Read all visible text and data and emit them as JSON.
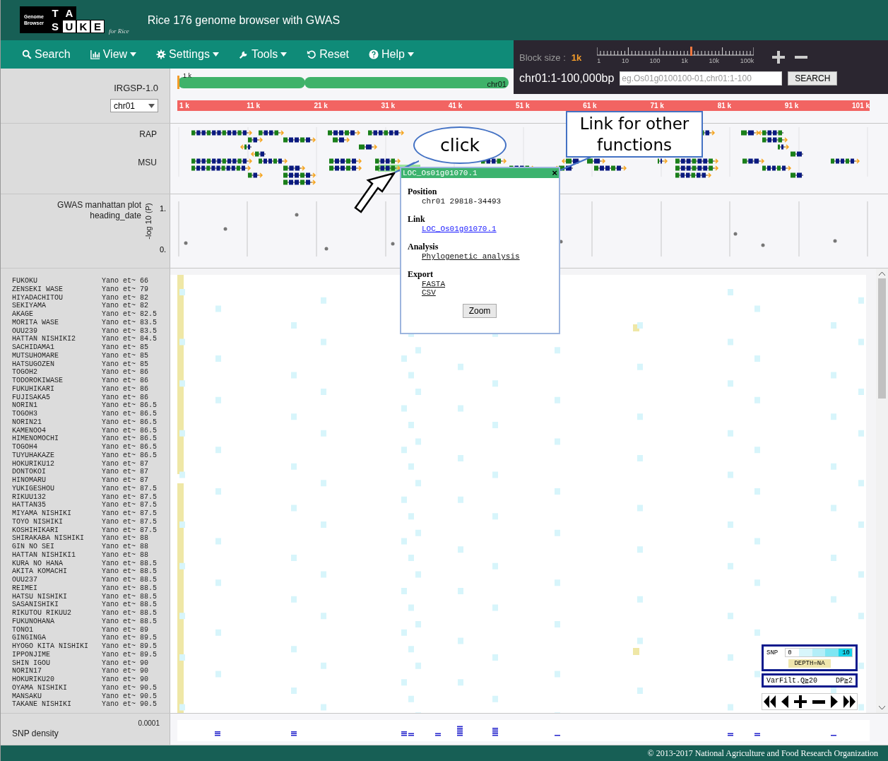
{
  "header": {
    "logo": {
      "caption": "Genome Browser",
      "letters": [
        {
          "char": "T",
          "dark": true
        },
        {
          "char": "A",
          "dark": true
        },
        {
          "char": "S",
          "dark": true
        },
        {
          "char": "U",
          "dark": false
        },
        {
          "char": "K",
          "dark": false
        },
        {
          "char": "E",
          "dark": false
        }
      ],
      "suffix": "for Rice"
    },
    "title": "Rice 176 genome browser with GWAS"
  },
  "nav": [
    {
      "label": "Search",
      "kind": "search",
      "has_menu": false
    },
    {
      "label": "View",
      "kind": "view",
      "has_menu": true
    },
    {
      "label": "Settings",
      "kind": "settings",
      "has_menu": true
    },
    {
      "label": "Tools",
      "kind": "tools",
      "has_menu": true
    },
    {
      "label": "Reset",
      "kind": "reset",
      "has_menu": false
    },
    {
      "label": "Help",
      "kind": "help",
      "has_menu": true
    }
  ],
  "block_size": {
    "label": "Block size :",
    "value": "1k",
    "level": 0.6,
    "scale": [
      "1",
      "10",
      "100",
      "1k",
      "10k",
      "100k"
    ]
  },
  "locator": {
    "position": "chr01:1-100,000bp",
    "placeholder": "eg.Os01g0100100-01,chr01:1-100",
    "button": "SEARCH"
  },
  "reference": {
    "name": "IRGSP-1.0",
    "chromosome": "chr01",
    "bar_label": "chr01",
    "marker": "1 k",
    "ruler": [
      "1 k",
      "11 k",
      "21 k",
      "31 k",
      "41 k",
      "51 k",
      "61 k",
      "71 k",
      "81 k",
      "91 k",
      "101 k"
    ]
  },
  "tracks": [
    "RAP",
    "MSU"
  ],
  "gwas": {
    "title": "GWAS manhattan plot",
    "trait": "heading_date",
    "axis": "-log 10 (P)",
    "ticks": [
      "1.",
      "0."
    ]
  },
  "varieties": [
    {
      "name": "FUKOKU",
      "info": "Yano et~ 66"
    },
    {
      "name": "ZENSEKI WASE",
      "info": "Yano et~ 79"
    },
    {
      "name": "HIYADACHITOU",
      "info": "Yano et~ 82"
    },
    {
      "name": "SEKIYAMA",
      "info": "Yano et~ 82"
    },
    {
      "name": "AKAGE",
      "info": "Yano et~ 82.5"
    },
    {
      "name": "MORITA WASE",
      "info": "Yano et~ 83.5"
    },
    {
      "name": "OUU239",
      "info": "Yano et~ 83.5"
    },
    {
      "name": "HATTAN NISHIKI2",
      "info": "Yano et~ 84.5"
    },
    {
      "name": "SACHIDAMA1",
      "info": "Yano et~ 85"
    },
    {
      "name": "MUTSUHOMARE",
      "info": "Yano et~ 85"
    },
    {
      "name": "HATSUGOZEN",
      "info": "Yano et~ 85"
    },
    {
      "name": "TOGOH2",
      "info": "Yano et~ 86"
    },
    {
      "name": "TODOROKIWASE",
      "info": "Yano et~ 86"
    },
    {
      "name": "FUKUHIKARI",
      "info": "Yano et~ 86"
    },
    {
      "name": "FUJISAKA5",
      "info": "Yano et~ 86"
    },
    {
      "name": "NORIN1",
      "info": "Yano et~ 86.5"
    },
    {
      "name": "TOGOH3",
      "info": "Yano et~ 86.5"
    },
    {
      "name": "NORIN21",
      "info": "Yano et~ 86.5"
    },
    {
      "name": "KAMENOO4",
      "info": "Yano et~ 86.5"
    },
    {
      "name": "HIMENOMOCHI",
      "info": "Yano et~ 86.5"
    },
    {
      "name": "TOGOH4",
      "info": "Yano et~ 86.5"
    },
    {
      "name": "TUYUHAKAZE",
      "info": "Yano et~ 86.5"
    },
    {
      "name": "HOKURIKU12",
      "info": "Yano et~ 87"
    },
    {
      "name": "DONTOKOI",
      "info": "Yano et~ 87"
    },
    {
      "name": "HINOMARU",
      "info": "Yano et~ 87"
    },
    {
      "name": "YUKIGESHOU",
      "info": "Yano et~ 87.5"
    },
    {
      "name": "RIKUU132",
      "info": "Yano et~ 87.5"
    },
    {
      "name": "HATTAN35",
      "info": "Yano et~ 87.5"
    },
    {
      "name": "MIYAMA NISHIKI",
      "info": "Yano et~ 87.5"
    },
    {
      "name": "TOYO NISHIKI",
      "info": "Yano et~ 87.5"
    },
    {
      "name": "KOSHIHIKARI",
      "info": "Yano et~ 87.5"
    },
    {
      "name": "SHIRAKABA NISHIKI",
      "info": "Yano et~ 88"
    },
    {
      "name": "GIN NO SEI",
      "info": "Yano et~ 88"
    },
    {
      "name": "HATTAN NISHIKI1",
      "info": "Yano et~ 88"
    },
    {
      "name": "KURA NO HANA",
      "info": "Yano et~ 88.5"
    },
    {
      "name": "AKITA KOMACHI",
      "info": "Yano et~ 88.5"
    },
    {
      "name": "OUU237",
      "info": "Yano et~ 88.5"
    },
    {
      "name": "REIMEI",
      "info": "Yano et~ 88.5"
    },
    {
      "name": "HATSU NISHIKI",
      "info": "Yano et~ 88.5"
    },
    {
      "name": "SASANISHIKI",
      "info": "Yano et~ 88.5"
    },
    {
      "name": "RIKUTOU RIKUU2",
      "info": "Yano et~ 88.5"
    },
    {
      "name": "FUKUNOHANA",
      "info": "Yano et~ 88.5"
    },
    {
      "name": "TONO1",
      "info": "Yano et~ 89"
    },
    {
      "name": "GINGINGA",
      "info": "Yano et~ 89.5"
    },
    {
      "name": "HYOGO KITA NISHIKI",
      "info": "Yano et~ 89.5"
    },
    {
      "name": "IPPONJIME",
      "info": "Yano et~ 89.5"
    },
    {
      "name": "SHIN IGOU",
      "info": "Yano et~ 90"
    },
    {
      "name": "NORIN17",
      "info": "Yano et~ 90"
    },
    {
      "name": "HOKURIKU20",
      "info": "Yano et~ 90"
    },
    {
      "name": "OYAMA NISHIKI",
      "info": "Yano et~ 90.5"
    },
    {
      "name": "MANSAKU",
      "info": "Yano et~ 90.5"
    },
    {
      "name": "TAKANE NISHIKI",
      "info": "Yano et~ 90.5"
    }
  ],
  "legend": {
    "snp_label": "SNP",
    "min": "0",
    "max": "10",
    "depth": "DEPTH=NA",
    "filter": "VarFilt.Q≧20",
    "dp": "DP≧2"
  },
  "density": {
    "label": "SNP density",
    "value": "0.0001"
  },
  "popup": {
    "title": "LOC_Os01g01070.1",
    "close": "×",
    "sections": [
      {
        "heading": "Position",
        "entries": [
          {
            "text": "chr01 29818-34493",
            "kind": "plain"
          }
        ]
      },
      {
        "heading": "Link",
        "entries": [
          {
            "text": "LOC_Os01g01070.1",
            "kind": "link"
          }
        ]
      },
      {
        "heading": "Analysis",
        "entries": [
          {
            "text": "Phylogenetic analysis",
            "kind": "action"
          }
        ]
      },
      {
        "heading": "Export",
        "entries": [
          {
            "text": "FASTA",
            "kind": "action"
          },
          {
            "text": "CSV",
            "kind": "action"
          }
        ]
      }
    ],
    "button": "Zoom"
  },
  "annotations": {
    "click": "click",
    "link_note": "Link for other functions"
  },
  "footer": "© 2013-2017 National Agriculture and Food Research Organization"
}
